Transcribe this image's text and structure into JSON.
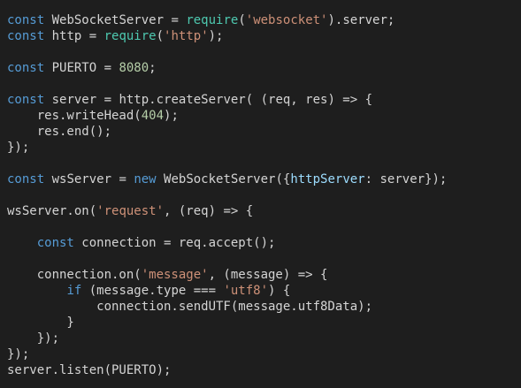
{
  "editor": {
    "colors": {
      "background": "#1e1e1e",
      "plain": "#d4d4d4",
      "keyword": "#569cd6",
      "function": "#4ec9b0",
      "string": "#ce9178",
      "number": "#b5cea8",
      "property": "#9cdcfe"
    },
    "lines": [
      [
        [
          "keyword",
          "const"
        ],
        [
          "plain",
          " WebSocketServer = "
        ],
        [
          "function",
          "require"
        ],
        [
          "plain",
          "("
        ],
        [
          "string",
          "'websocket'"
        ],
        [
          "plain",
          ").server;"
        ]
      ],
      [
        [
          "keyword",
          "const"
        ],
        [
          "plain",
          " http = "
        ],
        [
          "function",
          "require"
        ],
        [
          "plain",
          "("
        ],
        [
          "string",
          "'http'"
        ],
        [
          "plain",
          ");"
        ]
      ],
      [],
      [
        [
          "keyword",
          "const"
        ],
        [
          "plain",
          " PUERTO = "
        ],
        [
          "number",
          "8080"
        ],
        [
          "plain",
          ";"
        ]
      ],
      [],
      [
        [
          "keyword",
          "const"
        ],
        [
          "plain",
          " server = http.createServer( (req, res) => {"
        ]
      ],
      [
        [
          "plain",
          "    res.writeHead("
        ],
        [
          "number",
          "404"
        ],
        [
          "plain",
          ");"
        ]
      ],
      [
        [
          "plain",
          "    res.end();"
        ]
      ],
      [
        [
          "plain",
          "});"
        ]
      ],
      [],
      [
        [
          "keyword",
          "const"
        ],
        [
          "plain",
          " wsServer = "
        ],
        [
          "keyword",
          "new"
        ],
        [
          "plain",
          " WebSocketServer({"
        ],
        [
          "property",
          "httpServer"
        ],
        [
          "plain",
          ": server});"
        ]
      ],
      [],
      [
        [
          "plain",
          "wsServer.on("
        ],
        [
          "string",
          "'request'"
        ],
        [
          "plain",
          ", (req) => {"
        ]
      ],
      [],
      [
        [
          "plain",
          "    "
        ],
        [
          "keyword",
          "const"
        ],
        [
          "plain",
          " connection = req.accept();"
        ]
      ],
      [],
      [
        [
          "plain",
          "    connection.on("
        ],
        [
          "string",
          "'message'"
        ],
        [
          "plain",
          ", (message) => {"
        ]
      ],
      [
        [
          "plain",
          "        "
        ],
        [
          "keyword",
          "if"
        ],
        [
          "plain",
          " (message.type === "
        ],
        [
          "string",
          "'utf8'"
        ],
        [
          "plain",
          ") {"
        ]
      ],
      [
        [
          "plain",
          "            connection.sendUTF(message.utf8Data);"
        ]
      ],
      [
        [
          "plain",
          "        }"
        ]
      ],
      [
        [
          "plain",
          "    });"
        ]
      ],
      [
        [
          "plain",
          "});"
        ]
      ],
      [
        [
          "plain",
          "server.listen(PUERTO);"
        ]
      ]
    ]
  }
}
